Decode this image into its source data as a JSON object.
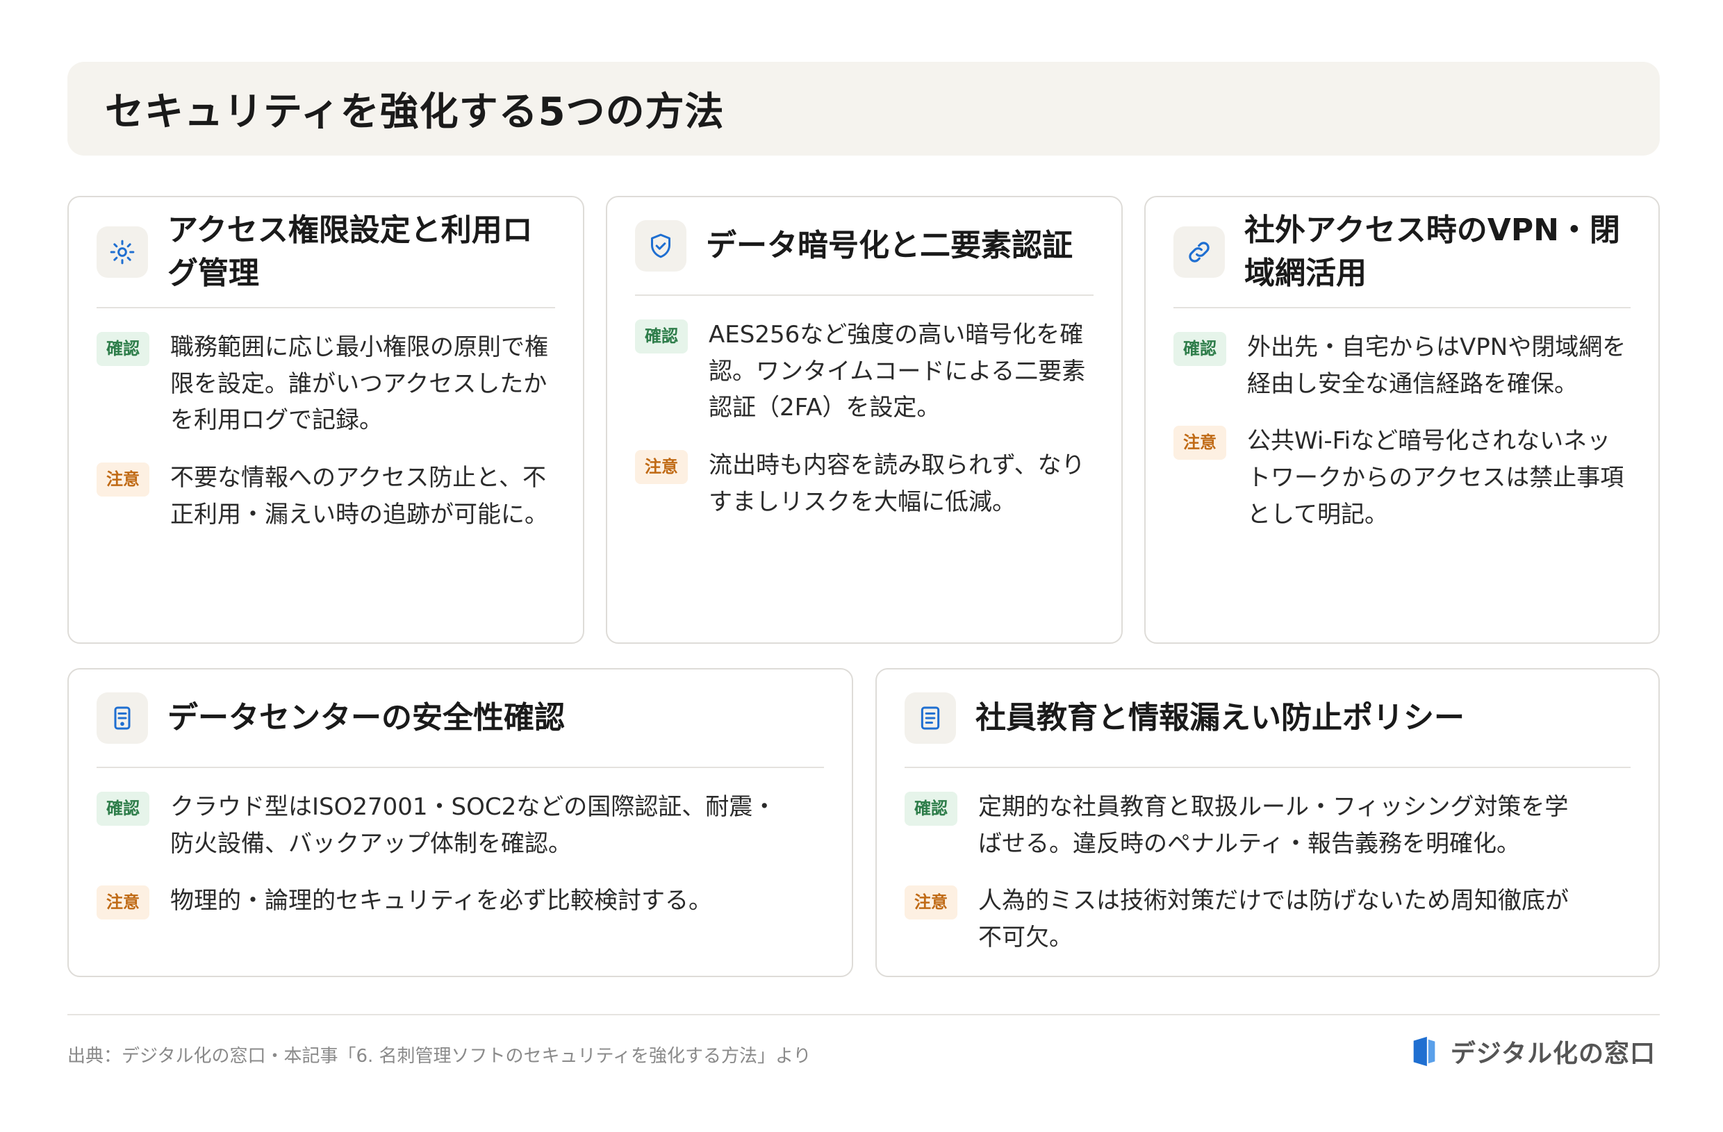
{
  "title": "セキュリティを強化する5つの方法",
  "cards": [
    {
      "icon": "gear-icon",
      "title": "アクセス権限設定と利用ログ管理",
      "confirm_label": "確認",
      "confirm_text": "職務範囲に応じ最小権限の原則で権限を設定。誰がいつアクセスしたかを利用ログで記録。",
      "warn_label": "注意",
      "warn_text": "不要な情報へのアクセス防止と、不正利用・漏えい時の追跡が可能に。"
    },
    {
      "icon": "shield-check-icon",
      "title": "データ暗号化と二要素認証",
      "confirm_label": "確認",
      "confirm_text": "AES256など強度の高い暗号化を確認。ワンタイムコードによる二要素認証（2FA）を設定。",
      "warn_label": "注意",
      "warn_text": "流出時も内容を読み取られず、なりすましリスクを大幅に低減。"
    },
    {
      "icon": "link-icon",
      "title": "社外アクセス時のVPN・閉域網活用",
      "confirm_label": "確認",
      "confirm_text": "外出先・自宅からはVPNや閉域網を経由し安全な通信経路を確保。",
      "warn_label": "注意",
      "warn_text": "公共Wi-Fiなど暗号化されないネットワークからのアクセスは禁止事項として明記。"
    },
    {
      "icon": "server-icon",
      "title": "データセンターの安全性確認",
      "confirm_label": "確認",
      "confirm_text": "クラウド型はISO27001・SOC2などの国際認証、耐震・防火設備、バックアップ体制を確認。",
      "warn_label": "注意",
      "warn_text": "物理的・論理的セキュリティを必ず比較検討する。"
    },
    {
      "icon": "document-icon",
      "title": "社員教育と情報漏えい防止ポリシー",
      "confirm_label": "確認",
      "confirm_text": "定期的な社員教育と取扱ルール・フィッシング対策を学ばせる。違反時のペナルティ・報告義務を明確化。",
      "warn_label": "注意",
      "warn_text": "人為的ミスは技術対策だけでは防げないため周知徹底が不可欠。"
    }
  ],
  "footer": {
    "source": "出典：デジタル化の窓口・本記事「6. 名刺管理ソフトのセキュリティを強化する方法」より",
    "brand": "デジタル化の窓口"
  },
  "colors": {
    "accent": "#1f6fd1",
    "confirm": "#2e7d4a",
    "warn": "#c06a15"
  }
}
